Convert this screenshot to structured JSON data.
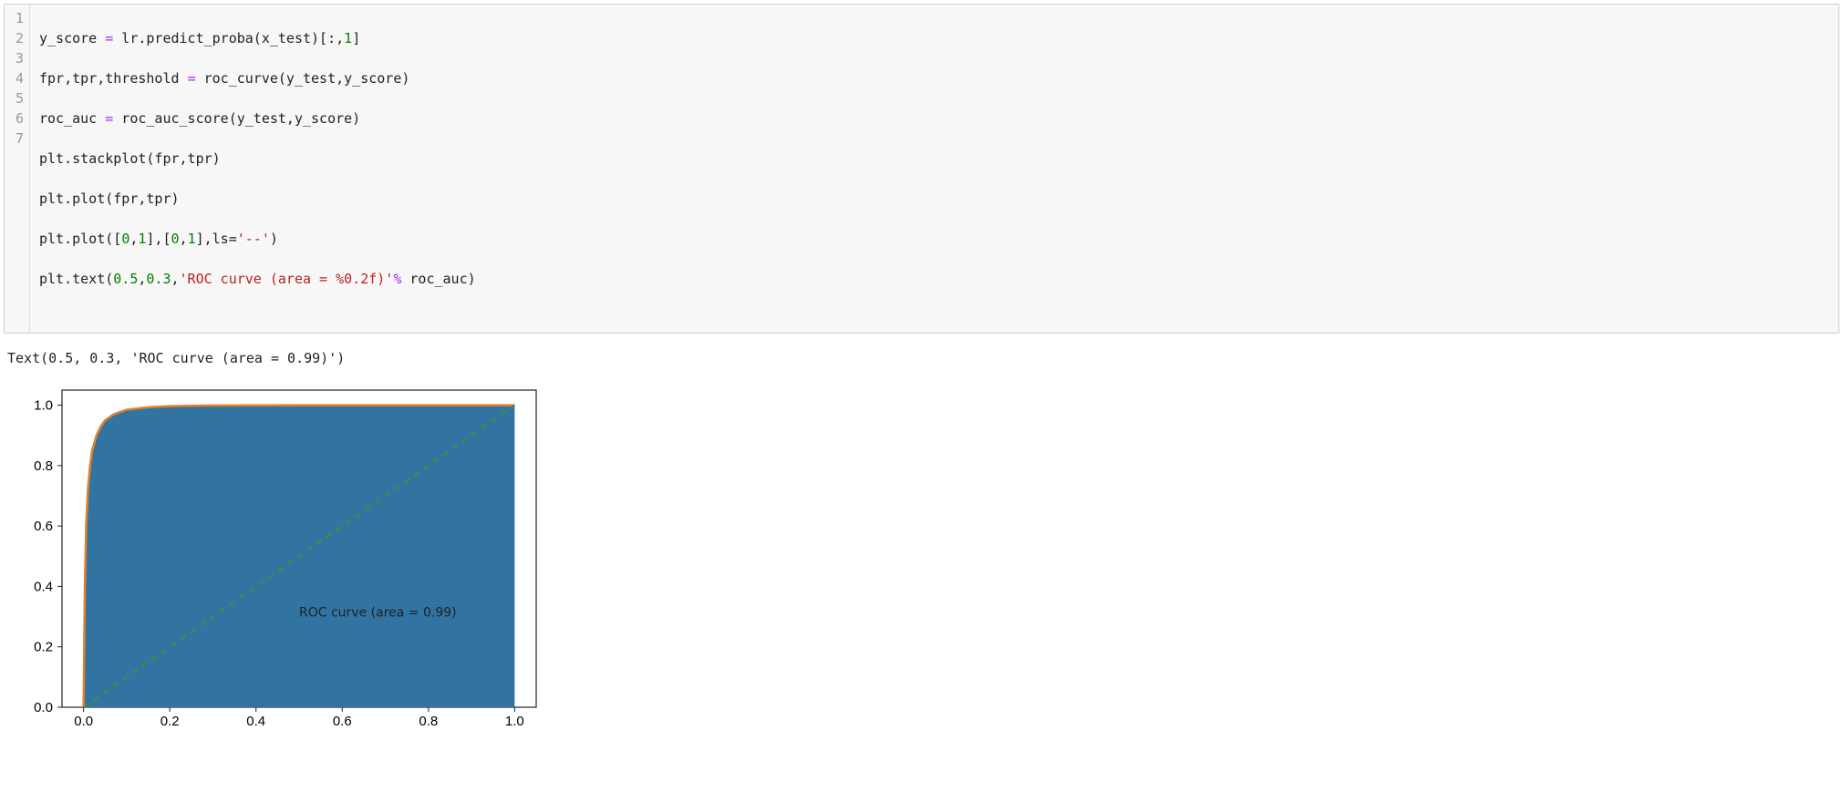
{
  "code": {
    "line1": {
      "a": "y_score ",
      "b": "=",
      "c": " lr.predict_proba(x_test)[:,",
      "d": "1",
      "e": "]"
    },
    "line2": {
      "a": "fpr,tpr,threshold ",
      "b": "=",
      "c": " roc_curve(y_test,y_score)"
    },
    "line3": {
      "a": "roc_auc ",
      "b": "=",
      "c": " roc_auc_score(y_test,y_score)"
    },
    "line4": "plt.stackplot(fpr,tpr)",
    "line5": "plt.plot(fpr,tpr)",
    "line6": {
      "a": "plt.plot([",
      "b": "0",
      "c": ",",
      "d": "1",
      "e": "],[",
      "f": "0",
      "g": ",",
      "h": "1",
      "i": "],ls=",
      "j": "'--'",
      "k": ")"
    },
    "line7": {
      "a": "plt.text(",
      "b": "0.5",
      "c": ",",
      "d": "0.3",
      "e": ",",
      "f": "'ROC curve (area = %0.2f)'",
      "g": "%",
      "h": " roc_auc)"
    }
  },
  "gutter": {
    "l1": "1",
    "l2": "2",
    "l3": "3",
    "l4": "4",
    "l5": "5",
    "l6": "6",
    "l7": "7"
  },
  "output": "Text(0.5, 0.3, 'ROC curve (area = 0.99)')",
  "chart_data": {
    "type": "area",
    "title": "",
    "xlabel": "",
    "ylabel": "",
    "xlim": [
      -0.05,
      1.05
    ],
    "ylim": [
      0.0,
      1.05
    ],
    "xticks": [
      0.0,
      0.2,
      0.4,
      0.6,
      0.8,
      1.0
    ],
    "yticks": [
      0.0,
      0.2,
      0.4,
      0.6,
      0.8,
      1.0
    ],
    "series": [
      {
        "name": "roc",
        "type": "area+line",
        "x": [
          0.0,
          0.003,
          0.006,
          0.01,
          0.015,
          0.02,
          0.03,
          0.04,
          0.05,
          0.07,
          0.1,
          0.15,
          0.2,
          0.3,
          0.5,
          0.7,
          1.0
        ],
        "y": [
          0.0,
          0.4,
          0.6,
          0.72,
          0.8,
          0.85,
          0.9,
          0.93,
          0.95,
          0.97,
          0.985,
          0.993,
          0.997,
          0.999,
          1.0,
          1.0,
          1.0
        ]
      },
      {
        "name": "diagonal",
        "type": "line",
        "x": [
          0,
          1
        ],
        "y": [
          0,
          1
        ],
        "style": "dashed"
      }
    ],
    "annotation": {
      "x": 0.5,
      "y": 0.3,
      "text": "ROC curve (area = 0.99)"
    },
    "roc_auc": 0.99
  },
  "ticks": {
    "x": {
      "0": "0.0",
      "1": "0.2",
      "2": "0.4",
      "3": "0.6",
      "4": "0.8",
      "5": "1.0"
    },
    "y": {
      "0": "0.0",
      "1": "0.2",
      "2": "0.4",
      "3": "0.6",
      "4": "0.8",
      "5": "1.0"
    }
  }
}
